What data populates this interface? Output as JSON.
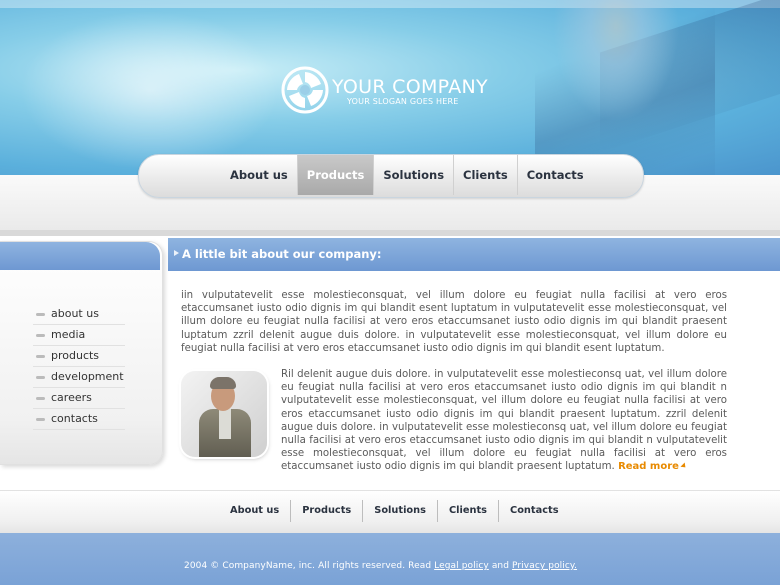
{
  "header": {
    "brand": "YOUR COMPANY",
    "slogan": "YOUR SLOGAN GOES HERE",
    "logo_icon": "swirl-logo-icon"
  },
  "nav": {
    "items": [
      "About us",
      "Products",
      "Solutions",
      "Clients",
      "Contacts"
    ],
    "active": "Products"
  },
  "sidebar": {
    "items": [
      "about us",
      "media",
      "products",
      "development",
      "careers",
      "contacts"
    ]
  },
  "content": {
    "title": "A little bit about our company:",
    "paragraph1": "iin vulputatevelit esse molestieconsquat, vel illum dolore eu feugiat nulla facilisi at vero eros etaccumsanet iusto odio dignis im qui blandit esent luptatum in vulputatevelit esse molestieconsquat, vel illum dolore eu feugiat nulla facilisi at vero eros etaccumsanet iusto odio dignis im qui blandit praesent luptatum zzril delenit augue duis dolore. in vulputatevelit esse molestieconsquat, vel illum dolore eu feugiat nulla facilisi at vero eros etaccumsanet iusto odio dignis im qui blandit esent luptatum.",
    "paragraph2": "Ril delenit augue duis dolore. in vulputatevelit esse molestieconsq uat, vel illum dolore eu feugiat nulla facilisi at vero eros etaccumsanet iusto odio dignis im qui blandit n vulputatevelit esse molestieconsquat, vel illum dolore eu feugiat nulla facilisi at vero eros etaccumsanet iusto odio dignis im qui blandit praesent luptatum. zzril delenit augue duis dolore. in vulputatevelit esse molestieconsq uat, vel illum dolore eu feugiat nulla facilisi at vero eros etaccumsanet iusto odio dignis im qui blandit n vulputatevelit esse molestieconsquat, vel illum dolore eu feugiat nulla facilisi at vero eros etaccumsanet iusto odio dignis im qui blandit praesent luptatum.",
    "read_more": "Read more"
  },
  "footer_nav": {
    "items": [
      "About us",
      "Products",
      "Solutions",
      "Clients",
      "Contacts"
    ]
  },
  "copyright": {
    "text": "2004 © CompanyName, inc. All rights reserved. Read",
    "legal": "Legal policy",
    "and": "and",
    "privacy": "Privacy policy."
  }
}
